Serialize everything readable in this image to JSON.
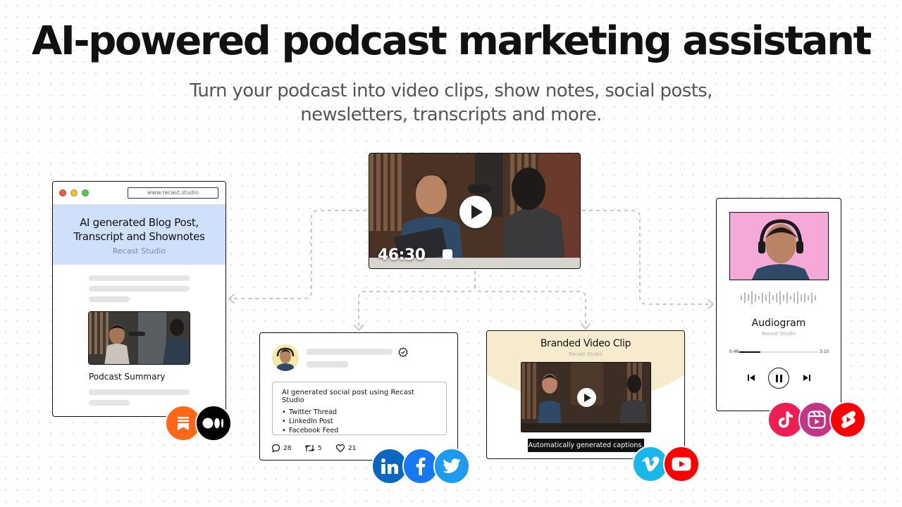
{
  "hero": {
    "title": "AI-powered podcast marketing assistant",
    "subtitle_line1": "Turn your podcast into video clips, show notes, social posts,",
    "subtitle_line2": "newsletters, transcripts and more."
  },
  "video_player": {
    "timecode": "46:30",
    "play_icon": "play-icon"
  },
  "blog_card": {
    "url": "www.recast.studio",
    "title_line1": "AI generated Blog Post,",
    "title_line2": "Transcript and Shownotes",
    "brand": "Recast Studio",
    "summary_label": "Podcast Summary",
    "hero_color": "#cfe0fb"
  },
  "social_card": {
    "post_heading": "AI generated social post using Recast Studio",
    "items": [
      "Twitter Thread",
      "LinkedIn Post",
      "Facebook Feed"
    ],
    "comments": "28",
    "retweets": "5",
    "likes": "21"
  },
  "clip_card": {
    "title": "Branded Video Clip",
    "brand": "Recast Studio",
    "caption": "Automatically generated captions.",
    "bg_color": "#f6eccd"
  },
  "audiogram_card": {
    "title": "Audiogram",
    "brand": "Recast Studio",
    "current_time": "0:48",
    "total_time": "3:15",
    "progress": 0.27,
    "photo_bg": "#f5a9d7"
  },
  "platforms": {
    "blog": [
      {
        "name": "substack-icon",
        "color": "#ff6719"
      },
      {
        "name": "medium-icon",
        "color": "#000000"
      }
    ],
    "social": [
      {
        "name": "linkedin-icon",
        "color": "#0a66c2"
      },
      {
        "name": "facebook-icon",
        "color": "#1877f2"
      },
      {
        "name": "twitter-icon",
        "color": "#1d9bf0"
      }
    ],
    "clip": [
      {
        "name": "vimeo-icon",
        "color": "#1ab7ea"
      },
      {
        "name": "youtube-icon",
        "color": "#ff0000"
      }
    ],
    "audiogram": [
      {
        "name": "tiktok-icon",
        "color": "#ee1d52"
      },
      {
        "name": "instagram-reels-icon",
        "color": "#c13584"
      },
      {
        "name": "youtube-shorts-icon",
        "color": "#ff0000"
      }
    ]
  }
}
